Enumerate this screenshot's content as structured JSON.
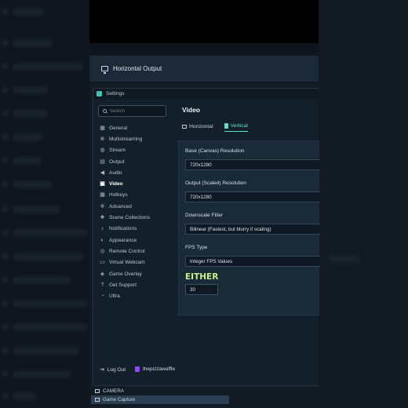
{
  "window": {
    "title": "Horizontal Output",
    "settings_title": "Settings"
  },
  "search": {
    "placeholder": "Search"
  },
  "sidebar": {
    "items": [
      {
        "label": "General",
        "icon": "grid-icon"
      },
      {
        "label": "Multistreaming",
        "icon": "multistream-icon"
      },
      {
        "label": "Stream",
        "icon": "globe-icon"
      },
      {
        "label": "Output",
        "icon": "output-icon"
      },
      {
        "label": "Audio",
        "icon": "speaker-icon"
      },
      {
        "label": "Video",
        "icon": "video-icon",
        "active": true
      },
      {
        "label": "Hotkeys",
        "icon": "keyboard-icon"
      },
      {
        "label": "Advanced",
        "icon": "gears-icon"
      },
      {
        "label": "Scene Collections",
        "icon": "collection-icon"
      },
      {
        "label": "Notifications",
        "icon": "bell-icon"
      },
      {
        "label": "Appearance",
        "icon": "palette-icon"
      },
      {
        "label": "Remote Control",
        "icon": "remote-icon"
      },
      {
        "label": "Virtual Webcam",
        "icon": "webcam-icon"
      },
      {
        "label": "Game Overlay",
        "icon": "overlay-icon"
      },
      {
        "label": "Get Support",
        "icon": "help-icon"
      },
      {
        "label": "Ultra",
        "icon": "ultra-icon"
      }
    ],
    "logout_label": "Log Out",
    "username": "thepizzawaffle"
  },
  "content": {
    "title": "Video",
    "tabs": [
      {
        "label": "Horizontal",
        "active": false
      },
      {
        "label": "Vertical",
        "active": true
      }
    ],
    "fields": {
      "base_label": "Base (Canvas) Resolution",
      "base_value": "720x1280",
      "output_label": "Output (Scaled) Resolution",
      "output_value": "720x1280",
      "filter_label": "Downscale Filter",
      "filter_value": "Bilinear (Fastest, but blurry if scaling)",
      "fps_type_label": "FPS Type",
      "fps_type_value": "Integer FPS Values",
      "overlay_text": "EITHER",
      "fps_value": "30"
    }
  },
  "bottom_list": {
    "camera": "CAMERA",
    "game_capture": "Game Capture"
  },
  "colors": {
    "accent": "#5ee0c8",
    "overlay_text": "#c6f08a",
    "twitch": "#9146ff"
  }
}
